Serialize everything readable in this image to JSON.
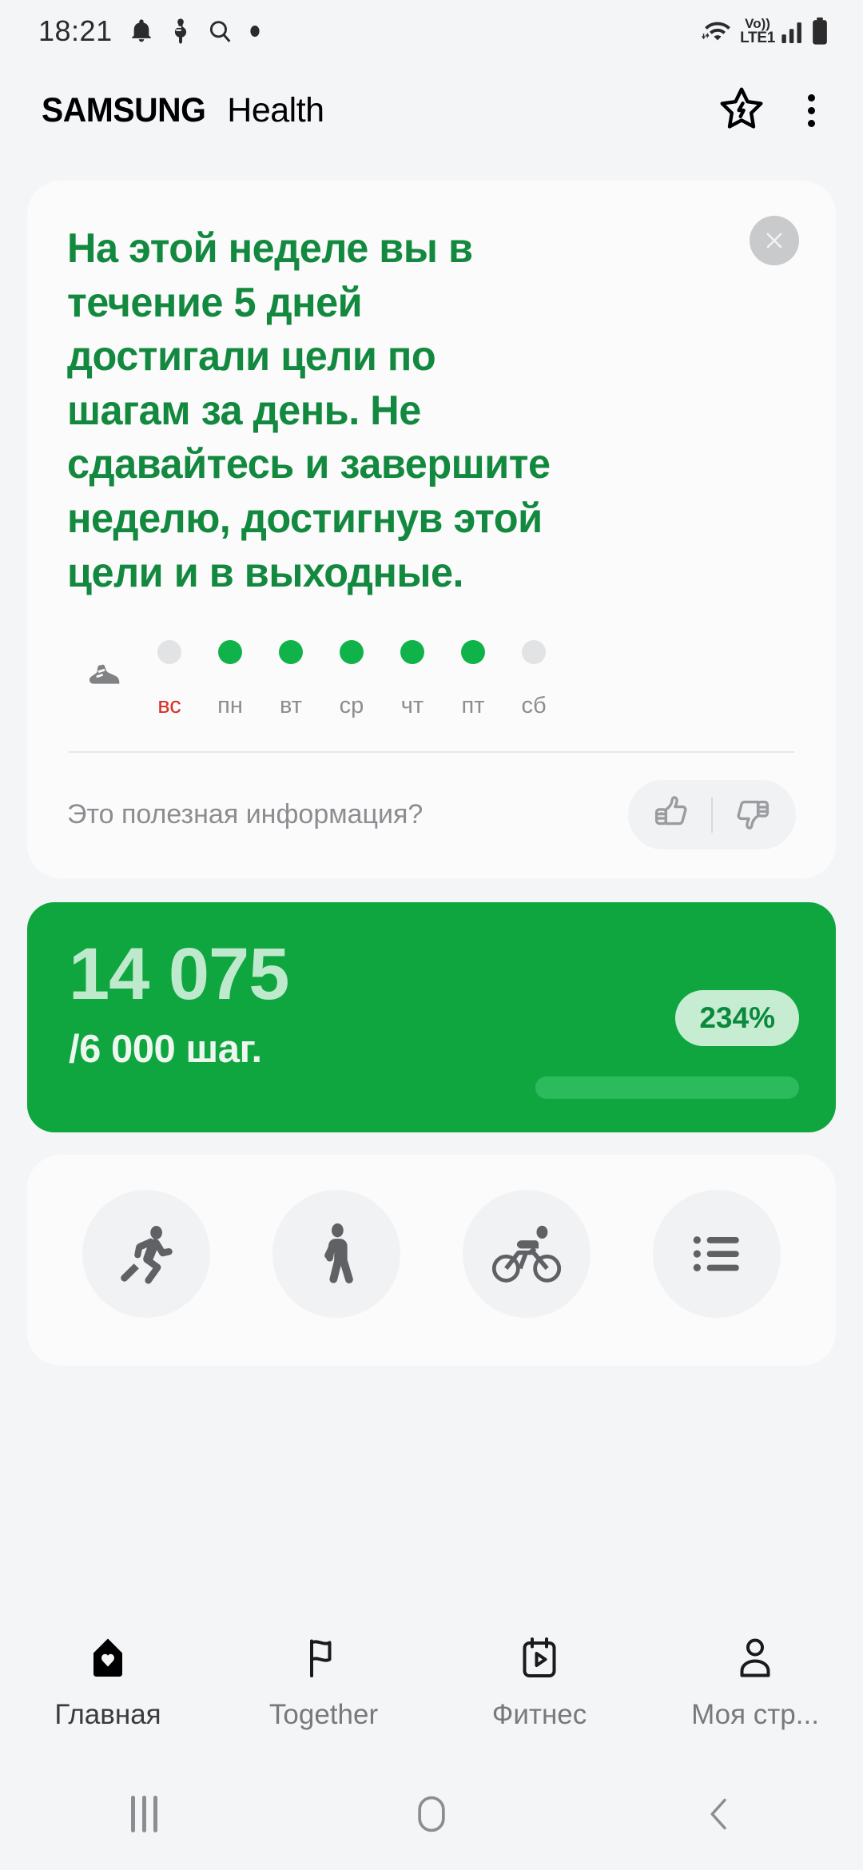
{
  "status_bar": {
    "time": "18:21",
    "left_icons": [
      "bell-icon",
      "do-not-disturb-icon",
      "search-icon",
      "dot-icon"
    ],
    "right": {
      "wifi": "wifi-icon",
      "volte_top": "Vo))",
      "volte_bottom": "LTE1",
      "signal": "signal-bars-icon",
      "battery": "battery-icon"
    }
  },
  "app_bar": {
    "brand_samsung": "SAMSUNG",
    "brand_app": "Health",
    "favorite_icon": "star-icon",
    "overflow_icon": "more-vertical-icon"
  },
  "insight_card": {
    "headline": "На этой неделе вы в течение 5 дней достигали цели по шагам за день. Не сдавайтесь и завершите неделю, достигнув этой цели и в выходные.",
    "close_icon": "close-icon",
    "streak_icon": "shoe-icon",
    "week": [
      {
        "label": "вс",
        "achieved": false,
        "is_today": true
      },
      {
        "label": "пн",
        "achieved": true,
        "is_today": false
      },
      {
        "label": "вт",
        "achieved": true,
        "is_today": false
      },
      {
        "label": "ср",
        "achieved": true,
        "is_today": false
      },
      {
        "label": "чт",
        "achieved": true,
        "is_today": false
      },
      {
        "label": "пт",
        "achieved": true,
        "is_today": false
      },
      {
        "label": "сб",
        "achieved": false,
        "is_today": false
      }
    ],
    "feedback_question": "Это полезная информация?",
    "thumbs_up_icon": "thumbs-up-icon",
    "thumbs_down_icon": "thumbs-down-icon"
  },
  "steps_card": {
    "count": "14 075",
    "goal": "/6 000 шаг.",
    "percent": "234%",
    "progress_value": 100,
    "bg_color": "#0fa63f",
    "badge_bg": "#c6ecd2",
    "badge_text_color": "#0a8a3c"
  },
  "activities": [
    {
      "icon": "running-icon"
    },
    {
      "icon": "walking-icon"
    },
    {
      "icon": "cycling-icon"
    },
    {
      "icon": "list-icon"
    }
  ],
  "bottom_nav": [
    {
      "label": "Главная",
      "icon": "home-heart-icon",
      "active": true
    },
    {
      "label": "Together",
      "icon": "flag-icon",
      "active": false
    },
    {
      "label": "Фитнес",
      "icon": "calendar-play-icon",
      "active": false
    },
    {
      "label": "Моя стр...",
      "icon": "person-icon",
      "active": false
    }
  ],
  "system_nav": {
    "recents": "recents-icon",
    "home": "home-circle-icon",
    "back": "back-chevron-icon"
  }
}
